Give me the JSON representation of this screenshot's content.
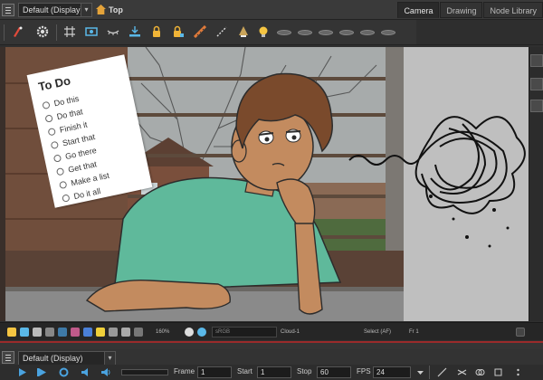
{
  "app": {
    "view_display": "Default (Display)",
    "breadcrumb": "Top",
    "tabs": [
      {
        "label": "Camera",
        "active": true
      },
      {
        "label": "Drawing",
        "active": false
      },
      {
        "label": "Node Library",
        "active": false
      }
    ]
  },
  "toolbar": {
    "icons": [
      "pen-tool-icon",
      "gear-icon",
      "grid-icon",
      "camera-mask-icon",
      "onion-skin-icon",
      "ground-icon",
      "lock-icon",
      "lock-all-icon",
      "ruler-icon",
      "line-icon",
      "light-icon",
      "lightbulb-icon",
      "pill-icon"
    ]
  },
  "todo": {
    "title": "To Do",
    "items": [
      "Do this",
      "Do that",
      "Finish it",
      "Start that",
      "Go there",
      "Get that",
      "Make a list",
      "Do it all"
    ]
  },
  "statusbar": {
    "zoom": "160%",
    "color_space": "sRGB",
    "drawing_name": "Cloud-1",
    "selection": "Select (AF)",
    "frame": "Fr 1"
  },
  "timeline": {
    "display": "Default (Display)",
    "frame_label": "Frame",
    "frame_value": "1",
    "start_label": "Start",
    "start_value": "1",
    "stop_label": "Stop",
    "stop_value": "60",
    "fps_label": "FPS",
    "fps_value": "24"
  },
  "colors": {
    "accent_red": "#9a2b2b",
    "ui_dark": "#2f2f2f",
    "skin": "#c38b5f",
    "hair": "#7a4a2c",
    "shirt": "#5fb99b",
    "table": "#8c8c8c"
  }
}
